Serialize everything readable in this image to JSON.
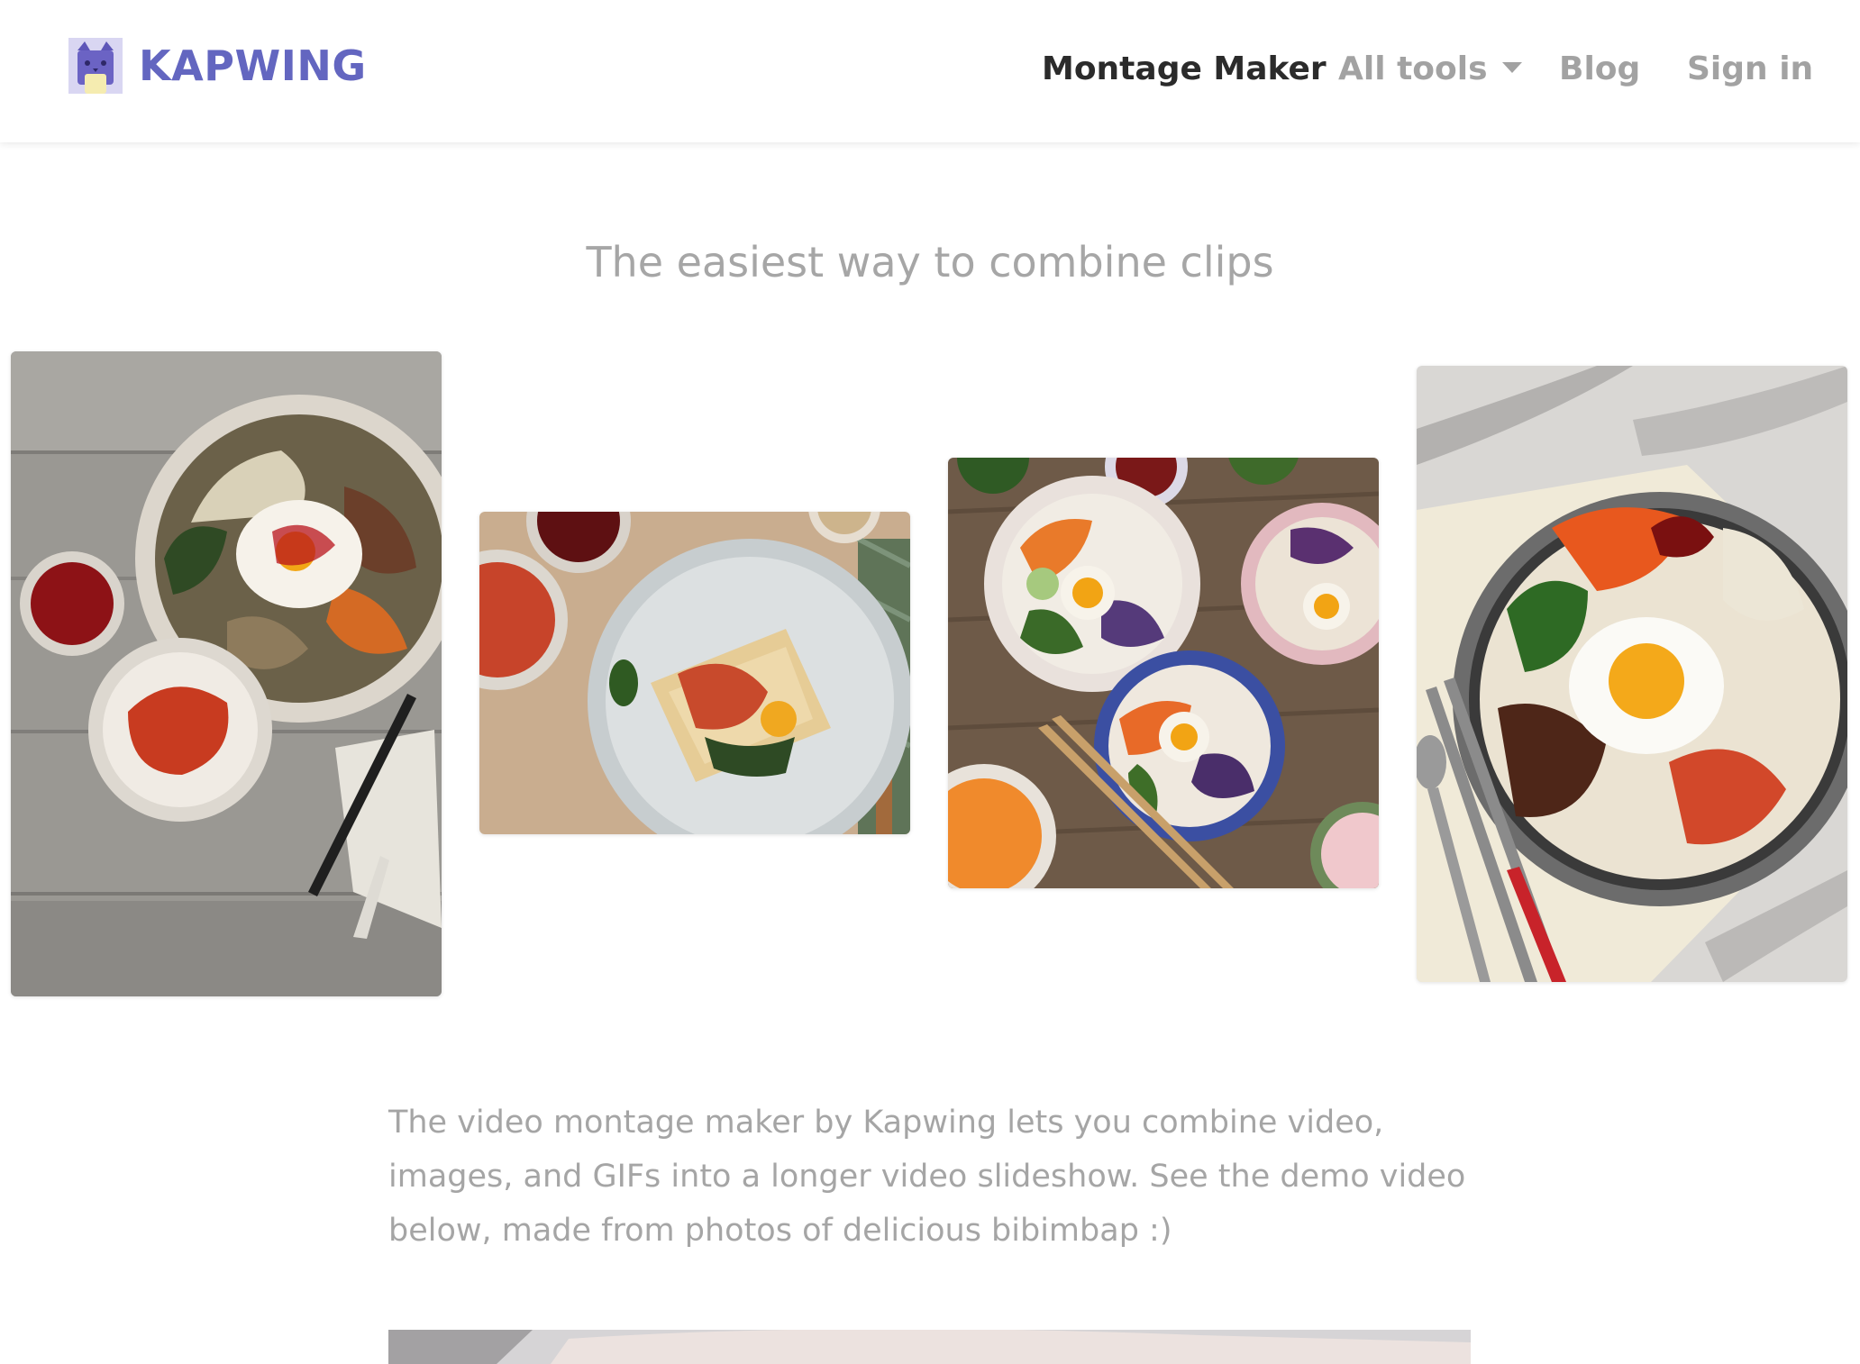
{
  "brand": {
    "name": "KAPWING",
    "color": "#6366c0"
  },
  "nav": {
    "active": "Montage Maker",
    "all_tools": "All tools",
    "blog": "Blog",
    "sign_in": "Sign in"
  },
  "hero": {
    "title": "The easiest way to combine clips"
  },
  "gallery": {
    "photos": [
      {
        "subject": "bibimbap bowl with egg, kimchi and chili sauce on wood table"
      },
      {
        "subject": "waffle topped with kimchi and egg on grey plate"
      },
      {
        "subject": "three bibimbap bowls with chopsticks on wood table"
      },
      {
        "subject": "dolsot bibimbap with fried egg on marble and cloth"
      }
    ]
  },
  "description": {
    "text": "The video montage maker by Kapwing lets you combine video, images, and GIFs into a longer video slideshow. See the demo video below, made from photos of delicious bibimbap :)"
  },
  "colors": {
    "active_nav": "#2b2b2b",
    "muted_nav": "#a2a2a2",
    "muted_text": "#a5a5a5"
  }
}
